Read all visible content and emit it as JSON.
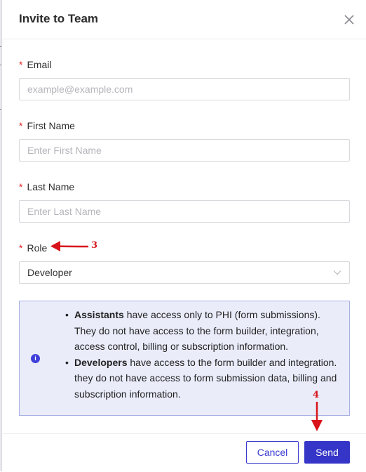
{
  "dialog": {
    "title": "Invite to Team",
    "close_icon": "close-icon"
  },
  "form": {
    "required_marker": "*",
    "email": {
      "label": "Email",
      "placeholder": "example@example.com",
      "value": ""
    },
    "first_name": {
      "label": "First Name",
      "placeholder": "Enter First Name",
      "value": ""
    },
    "last_name": {
      "label": "Last Name",
      "placeholder": "Enter Last Name",
      "value": ""
    },
    "role": {
      "label": "Role",
      "value": "Developer",
      "icon": "chevron-down-icon"
    }
  },
  "info": {
    "icon": "info-icon",
    "items": [
      {
        "bold": "Assistants",
        "text": " have access only to PHI (form submissions). They do not have access to the form builder, integration, access control, billing or subscription information."
      },
      {
        "bold": "Developers",
        "text": " have access to the form builder and integration. they do not have access to form submission data, billing and subscription information."
      }
    ]
  },
  "footer": {
    "cancel_label": "Cancel",
    "send_label": "Send"
  },
  "annotations": {
    "role_marker": "3",
    "send_marker": "4"
  },
  "colors": {
    "primary": "#3535c8",
    "required": "#e02020",
    "info_bg": "#eaecfa",
    "info_border": "#a9b0e4",
    "annotation": "#d8141a"
  }
}
